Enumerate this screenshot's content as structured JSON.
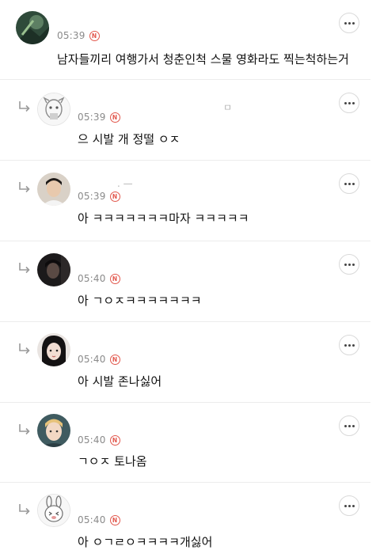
{
  "comments": [
    {
      "time": "05:39",
      "badge": "N",
      "nickname": "",
      "text": "남자들끼리 여행가서 청춘인척 스물 영화라도 찍는척하는거"
    },
    {
      "time": "05:39",
      "badge": "N",
      "nickname": "ㅁ",
      "text": "으 시발 개 정떨 ㅇㅈ"
    },
    {
      "time": "05:39",
      "badge": "N",
      "nickname": ". —",
      "text": "아 ㅋㅋㅋㅋㅋㅋㅋ마자 ㅋㅋㅋㅋㅋ"
    },
    {
      "time": "05:40",
      "badge": "N",
      "nickname": "",
      "text": "아 ㄱㅇㅈㅋㅋㅋㅋㅋㅋㅋ"
    },
    {
      "time": "05:40",
      "badge": "N",
      "nickname": "",
      "text": "아 시발 존나싫어"
    },
    {
      "time": "05:40",
      "badge": "N",
      "nickname": "",
      "text": "ㄱㅇㅈ 토나옴"
    },
    {
      "time": "05:40",
      "badge": "N",
      "nickname": "",
      "text": "아 ㅇㄱㄹㅇㅋㅋㅋㅋ개싫어"
    }
  ],
  "icons": {
    "reply": "reply-arrow-icon",
    "more": "more-options-icon",
    "new_badge": "new-badge-icon"
  },
  "colors": {
    "new_badge": "#e2574c",
    "time_text": "#8a8a8a",
    "divider": "#ececec"
  }
}
